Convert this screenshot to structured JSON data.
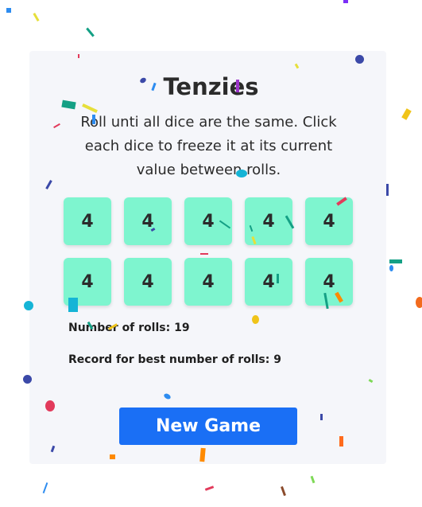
{
  "game": {
    "title": "Tenzies",
    "instructions": "Roll unti all dice are the same. Click each dice to freeze it at its current value between rolls.",
    "dice": [
      "4",
      "4",
      "4",
      "4",
      "4",
      "4",
      "4",
      "4",
      "4",
      "4"
    ],
    "stats": {
      "rolls": "Number of rolls: 19",
      "record": "Record for best number of rolls: 9"
    },
    "new_game_label": "New Game"
  },
  "colors": {
    "die_bg": "#7ef5cf",
    "button_bg": "#1a6ff5",
    "card_bg": "#f5f6fa"
  }
}
